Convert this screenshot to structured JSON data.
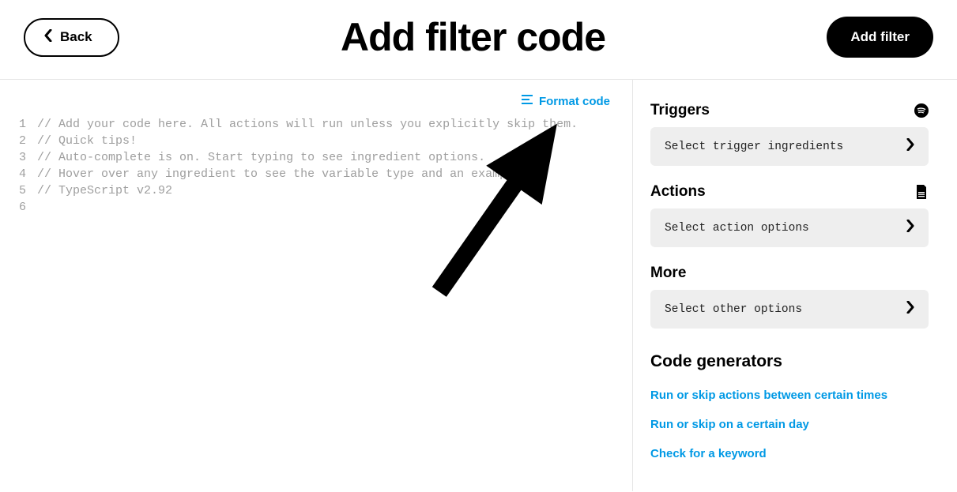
{
  "header": {
    "back_label": "Back",
    "title": "Add filter code",
    "add_filter_label": "Add filter"
  },
  "editor": {
    "format_label": "Format code",
    "lines": [
      "// Add your code here. All actions will run unless you explicitly skip them.",
      "// Quick tips!",
      "// Auto-complete is on. Start typing to see ingredient options.",
      "// Hover over any ingredient to see the variable type and an example.",
      "// TypeScript v2.92",
      ""
    ]
  },
  "sidebar": {
    "triggers": {
      "title": "Triggers",
      "placeholder": "Select trigger ingredients",
      "icon": "spotify-icon"
    },
    "actions": {
      "title": "Actions",
      "placeholder": "Select action options",
      "icon": "document-icon"
    },
    "more": {
      "title": "More",
      "placeholder": "Select other options"
    },
    "generators": {
      "title": "Code generators",
      "links": [
        "Run or skip actions between certain times",
        "Run or skip on a certain day",
        "Check for a keyword"
      ]
    }
  }
}
